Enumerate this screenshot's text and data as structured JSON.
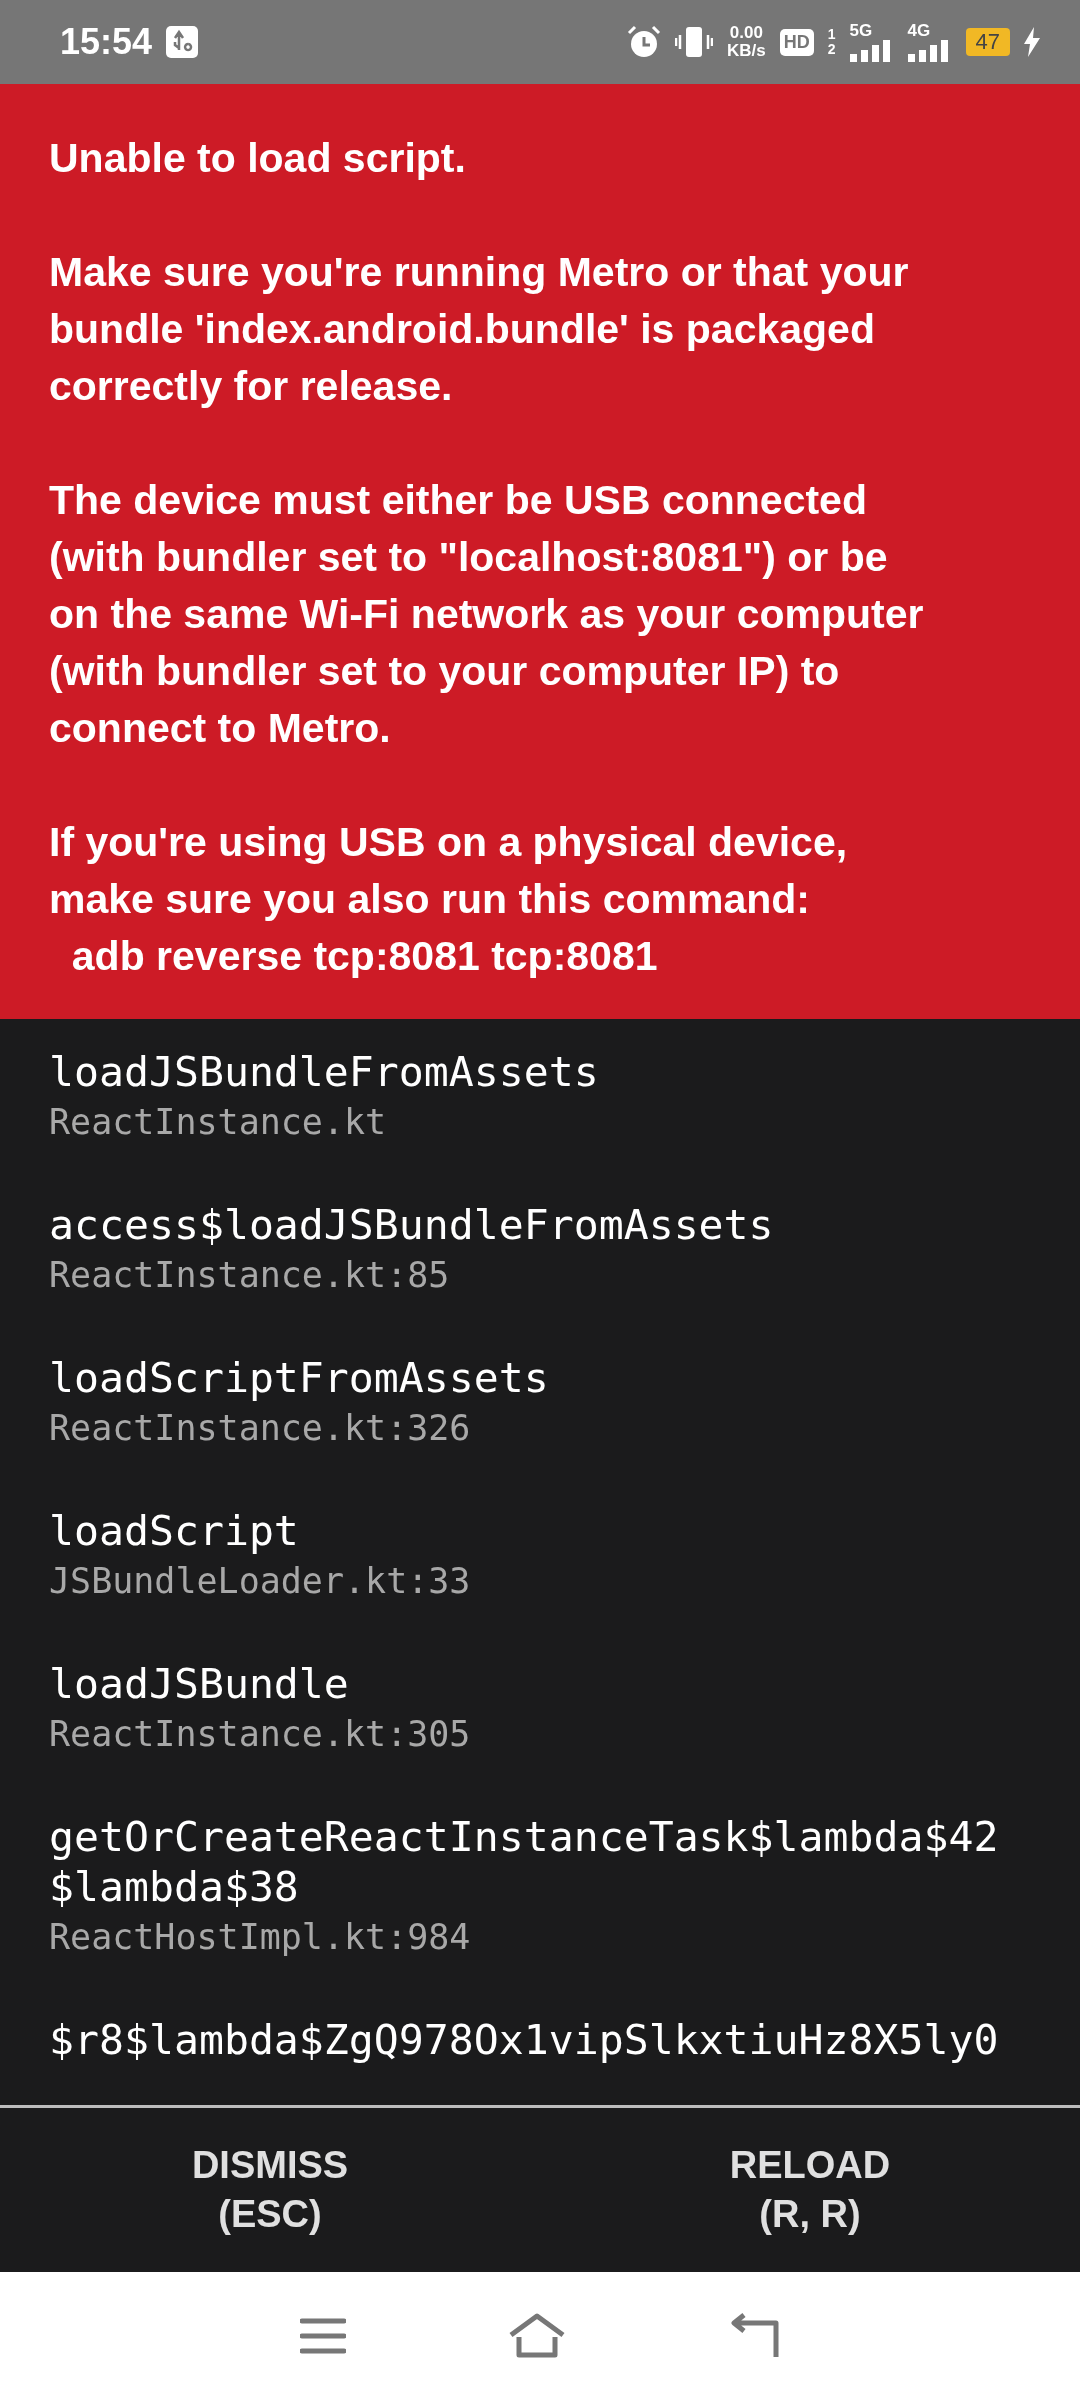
{
  "status_bar": {
    "time": "15:54",
    "speed_value": "0.00",
    "speed_unit": "KB/s",
    "hd": "HD",
    "sim_1": "1",
    "sim_2": "2",
    "networks": [
      "5G",
      "4G"
    ],
    "battery": "47",
    "charging": true
  },
  "error": {
    "paragraphs": [
      "Unable to load script.",
      "Make sure you're running Metro or that your\nbundle 'index.android.bundle' is packaged\ncorrectly for release.",
      "The device must either be USB connected\n(with bundler set to \"localhost:8081\") or be\non the same Wi-Fi network as your computer\n(with bundler set to your computer IP) to\nconnect to Metro.",
      "If you're using USB on a physical device,\nmake sure you also run this command:\n  adb reverse tcp:8081 tcp:8081"
    ]
  },
  "stack": [
    {
      "method": "loadJSBundleFromAssets",
      "file": "ReactInstance.kt"
    },
    {
      "method": "access$loadJSBundleFromAssets",
      "file": "ReactInstance.kt:85"
    },
    {
      "method": "loadScriptFromAssets",
      "file": "ReactInstance.kt:326"
    },
    {
      "method": "loadScript",
      "file": "JSBundleLoader.kt:33"
    },
    {
      "method": "loadJSBundle",
      "file": "ReactInstance.kt:305"
    },
    {
      "method": "getOrCreateReactInstanceTask$lambda$42$lambda$38",
      "file": "ReactHostImpl.kt:984"
    },
    {
      "method": "$r8$lambda$ZgQ978Ox1vipSlkxtiuHz8X5ly0"
    }
  ],
  "buttons": [
    {
      "label": "DISMISS\n(ESC)"
    },
    {
      "label": "RELOAD\n(R, R)"
    }
  ]
}
